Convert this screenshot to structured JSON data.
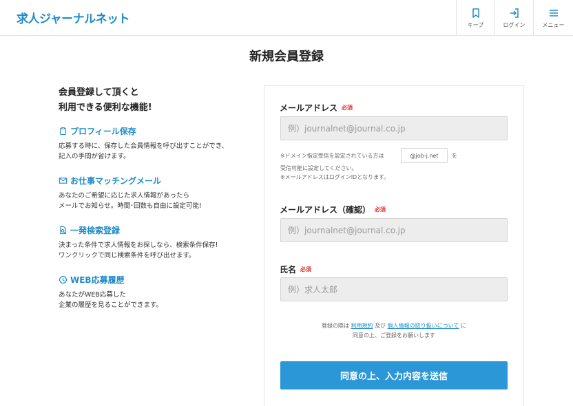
{
  "header": {
    "logo": "求人ジャーナルネット",
    "nav": [
      {
        "label": "キープ",
        "icon": "bookmark-icon"
      },
      {
        "label": "ログイン",
        "icon": "login-icon"
      },
      {
        "label": "メニュー",
        "icon": "menu-icon"
      }
    ]
  },
  "page": {
    "title": "新規会員登録"
  },
  "intro": {
    "line1": "会員登録して頂くと",
    "line2": "利用できる便利な機能!"
  },
  "features": [
    {
      "title": "プロフィール保存",
      "icon": "clipboard-icon",
      "desc1": "応募する時に、保存した会員情報を呼び出すことができ、",
      "desc2": "記入の手間が省けます。"
    },
    {
      "title": "お仕事マッチングメール",
      "icon": "mail-icon",
      "desc1": "あなたのご希望に応じた求人情報があったら",
      "desc2": "メールでお知らせ。時間･回数も自由に設定可能!"
    },
    {
      "title": "一発検索登録",
      "icon": "search-document-icon",
      "desc1": "決まった条件で求人情報をお探しなら、検索条件保存!",
      "desc2": "ワンクリックで同じ検索条件を呼び出せます。"
    },
    {
      "title": "WEB応募履歴",
      "icon": "history-clock-icon",
      "desc1": "あなたがWEB応募した",
      "desc2": "企業の履歴を見ることができます。"
    }
  ],
  "form": {
    "required": "必須",
    "email": {
      "label": "メールアドレス",
      "placeholder": "例）journalnet@journal.co.jp",
      "value": ""
    },
    "note_prefix": "※ドメイン指定受信を設定されている方は",
    "domain": "@job-j.net",
    "note_wo": "を",
    "note2": "受信可能に設定してください。",
    "note3": "※メールアドレスはログインIDとなります。",
    "email_confirm": {
      "label": "メールアドレス（確認）",
      "placeholder": "例）journalnet@journal.co.jp",
      "value": ""
    },
    "name": {
      "label": "氏名",
      "placeholder": "例）求人太郎",
      "value": ""
    },
    "agree_prefix": "登録の際は",
    "terms_link": "利用規約",
    "agree_and": "及び",
    "privacy_link": "個人情報の取り扱いについて",
    "agree_ni": "に",
    "agree_line2": "同意の上、ご登録をお願いします",
    "submit": "同意の上、入力内容を送信"
  },
  "colors": {
    "brand": "#1e8cc8",
    "button": "#2b97d6",
    "required": "#e0312b"
  }
}
